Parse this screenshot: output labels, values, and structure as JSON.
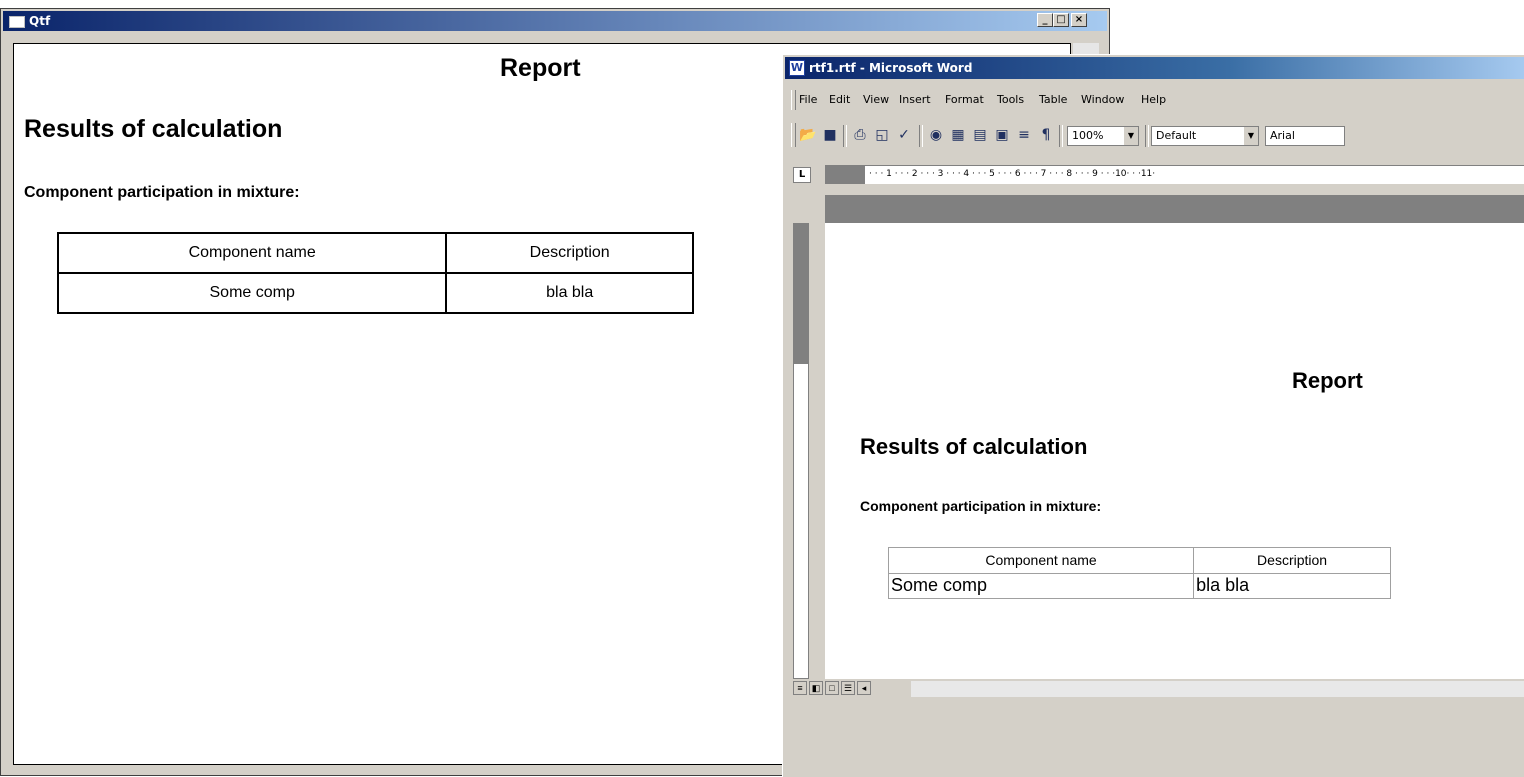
{
  "qtf": {
    "window_title": "Qtf",
    "caption_buttons": {
      "minimize": "_",
      "maximize": "□",
      "close": "×"
    },
    "report_title": "Report",
    "heading": "Results of calculation",
    "subheading": "Component participation in mixture:",
    "table": {
      "headers": [
        "Component name",
        "Description"
      ],
      "rows": [
        [
          "Some comp",
          "bla bla"
        ]
      ]
    },
    "scroll_down_glyph": "▼"
  },
  "word": {
    "window_title": "rtf1.rtf - Microsoft Word",
    "app_icon": "W",
    "menu": [
      "File",
      "Edit",
      "View",
      "Insert",
      "Format",
      "Tools",
      "Table",
      "Window",
      "Help"
    ],
    "toolbar": {
      "zoom": "100%",
      "style": "Default",
      "font": "Arial",
      "icons": [
        "open-icon",
        "save-icon",
        "print-icon",
        "print-preview-icon",
        "spelling-icon",
        "web-icon",
        "tables-borders-icon",
        "insert-table-icon",
        "insert-excel-icon",
        "columns-icon",
        "show-hide-icon"
      ]
    },
    "ruler_corner": "L",
    "ruler_text": "· · · 1 · · · 2 · · · 3 · · · 4 · · · 5 · · · 6 · · · 7 · · · 8 · · · 9 · · ·10· · ·11·",
    "report_title": "Report",
    "heading": "Results of calculation",
    "subheading": "Component participation in mixture:",
    "table": {
      "headers": [
        "Component name",
        "Description"
      ],
      "rows": [
        [
          "Some comp",
          "bla bla"
        ]
      ]
    }
  }
}
